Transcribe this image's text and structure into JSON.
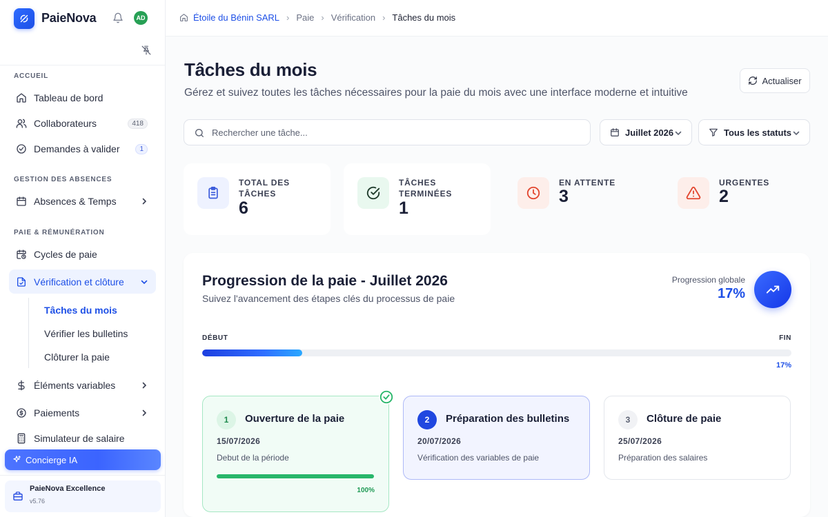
{
  "app": {
    "name": "PaieNova",
    "avatar_initials": "AD"
  },
  "sidebar": {
    "sections": {
      "accueil": "ACCUEIL",
      "absences": "GESTION DES ABSENCES",
      "paie": "PAIE & RÉMUNÉRATION"
    },
    "items": {
      "dashboard": "Tableau de bord",
      "collaborateurs": "Collaborateurs",
      "collaborateurs_count": "418",
      "demandes": "Demandes à valider",
      "demandes_count": "1",
      "absences": "Absences & Temps",
      "cycles": "Cycles de paie",
      "verification": "Vérification et clôture",
      "elements": "Éléments variables",
      "paiements": "Paiements",
      "simulateur": "Simulateur de salaire"
    },
    "sub_items": {
      "taches": "Tâches du mois",
      "bulletins": "Vérifier les bulletins",
      "cloturer": "Clôturer la paie"
    },
    "concierge": "Concierge IA",
    "plan": {
      "name": "PaieNova Excellence",
      "version": "v5.76"
    }
  },
  "breadcrumb": [
    "Étoile du Bénin SARL",
    "Paie",
    "Vérification",
    "Tâches du mois"
  ],
  "page": {
    "title": "Tâches du mois",
    "subtitle": "Gérez et suivez toutes les tâches nécessaires pour la paie du mois avec une interface moderne et intuitive",
    "refresh_label": "Actualiser"
  },
  "filters": {
    "search_placeholder": "Rechercher une tâche...",
    "month": "Juillet 2026",
    "status": "Tous les statuts"
  },
  "stats": [
    {
      "label": "Total des tâches",
      "value": "6",
      "color": "#3b5bdb"
    },
    {
      "label": "Tâches terminées",
      "value": "1",
      "color": "#1f8a4e"
    },
    {
      "label": "En attente",
      "value": "3",
      "color": "#e2462f"
    },
    {
      "label": "Urgentes",
      "value": "2",
      "color": "#e2462f"
    }
  ],
  "progress": {
    "title": "Progression de la paie - Juillet 2026",
    "subtitle": "Suivez l'avancement des étapes clés du processus de paie",
    "global_label": "Progression globale",
    "global_value": "17%",
    "start_label": "DÉBUT",
    "end_label": "FIN",
    "percent": 17,
    "percent_label": "17%"
  },
  "steps": [
    {
      "number": "1",
      "title": "Ouverture de la paie",
      "date": "15/07/2026",
      "description": "Debut de la période",
      "status": "done",
      "percent_label": "100%"
    },
    {
      "number": "2",
      "title": "Préparation des bulletins",
      "date": "20/07/2026",
      "description": "Vérification des variables de paie",
      "status": "current"
    },
    {
      "number": "3",
      "title": "Clôture de paie",
      "date": "25/07/2026",
      "description": "Préparation des salaires",
      "status": "upcoming"
    }
  ]
}
